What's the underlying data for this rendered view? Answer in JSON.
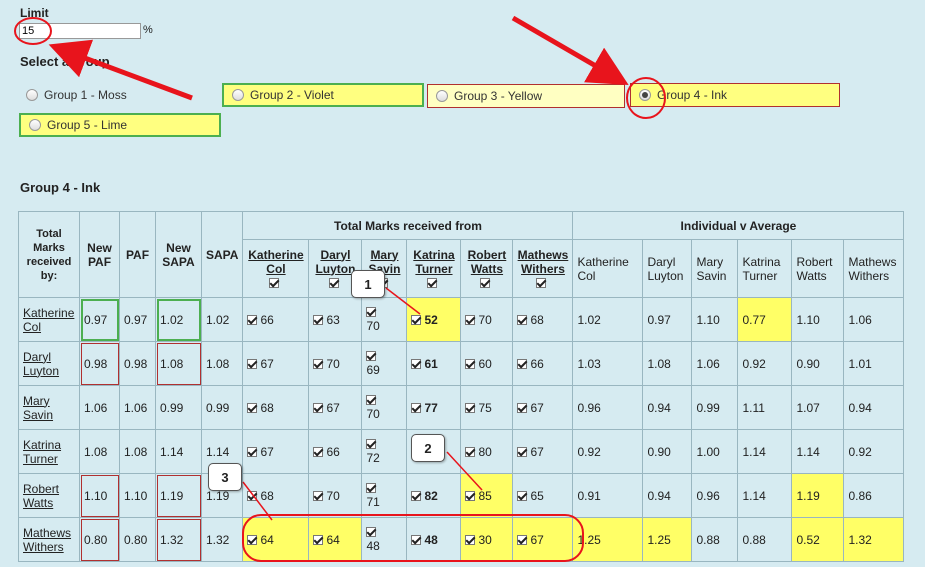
{
  "limit": {
    "label": "Limit",
    "value": "15",
    "suffix": "%"
  },
  "select_group_label": "Select a group",
  "groups": [
    {
      "label": "Group 1 - Moss",
      "selected": false
    },
    {
      "label": "Group 2 - Violet",
      "selected": false
    },
    {
      "label": "Group 3 - Yellow",
      "selected": false
    },
    {
      "label": "Group 4 - Ink",
      "selected": true
    },
    {
      "label": "Group 5 - Lime",
      "selected": false
    }
  ],
  "group_heading": "Group 4 - Ink",
  "table": {
    "head": {
      "total_marks_by": "Total Marks received by:",
      "new_paf": "New PAF",
      "paf": "PAF",
      "new_sapa": "New SAPA",
      "sapa": "SAPA",
      "total_from": "Total Marks received from",
      "ind_v_avg": "Individual v Average",
      "names": [
        "Katherine Col",
        "Daryl Luyton",
        "Mary Savin",
        "Katrina Turner",
        "Robert Watts",
        "Mathews Withers"
      ]
    },
    "rows": [
      {
        "name": "Katherine Col",
        "new_paf": "0.97",
        "paf": "0.97",
        "new_sapa": "1.02",
        "sapa": "1.02",
        "marks": [
          "66",
          "63",
          "70",
          "52",
          "70",
          "68"
        ],
        "ind": [
          "1.02",
          "0.97",
          "1.10",
          "0.77",
          "1.10",
          "1.06"
        ]
      },
      {
        "name": "Daryl Luyton",
        "new_paf": "0.98",
        "paf": "0.98",
        "new_sapa": "1.08",
        "sapa": "1.08",
        "marks": [
          "67",
          "70",
          "69",
          "61",
          "60",
          "66"
        ],
        "ind": [
          "1.03",
          "1.08",
          "1.06",
          "0.92",
          "0.90",
          "1.01"
        ]
      },
      {
        "name": "Mary Savin",
        "new_paf": "1.06",
        "paf": "1.06",
        "new_sapa": "0.99",
        "sapa": "0.99",
        "marks": [
          "68",
          "67",
          "70",
          "77",
          "75",
          "67"
        ],
        "ind": [
          "0.96",
          "0.94",
          "0.99",
          "1.11",
          "1.07",
          "0.94"
        ]
      },
      {
        "name": "Katrina Turner",
        "new_paf": "1.08",
        "paf": "1.08",
        "new_sapa": "1.14",
        "sapa": "1.14",
        "marks": [
          "67",
          "66",
          "72",
          "",
          "80",
          "67"
        ],
        "ind": [
          "0.92",
          "0.90",
          "1.00",
          "1.14",
          "1.14",
          "0.92"
        ]
      },
      {
        "name": "Robert Watts",
        "new_paf": "1.10",
        "paf": "1.10",
        "new_sapa": "1.19",
        "sapa": "1.19",
        "marks": [
          "68",
          "70",
          "71",
          "82",
          "85",
          "65"
        ],
        "ind": [
          "0.91",
          "0.94",
          "0.96",
          "1.14",
          "1.19",
          "0.86"
        ]
      },
      {
        "name": "Mathews Withers",
        "new_paf": "0.80",
        "paf": "0.80",
        "new_sapa": "1.32",
        "sapa": "1.32",
        "marks": [
          "64",
          "64",
          "48",
          "48",
          "30",
          "67"
        ],
        "ind": [
          "1.25",
          "1.25",
          "0.88",
          "0.88",
          "0.52",
          "1.32"
        ]
      }
    ]
  },
  "callouts": [
    "1",
    "2",
    "3"
  ],
  "colors": {
    "background": "#d6ebf1",
    "highlight": "#ffff66",
    "annotation": "#e8141c",
    "box_green": "#4caf50",
    "box_red": "#b03030"
  }
}
